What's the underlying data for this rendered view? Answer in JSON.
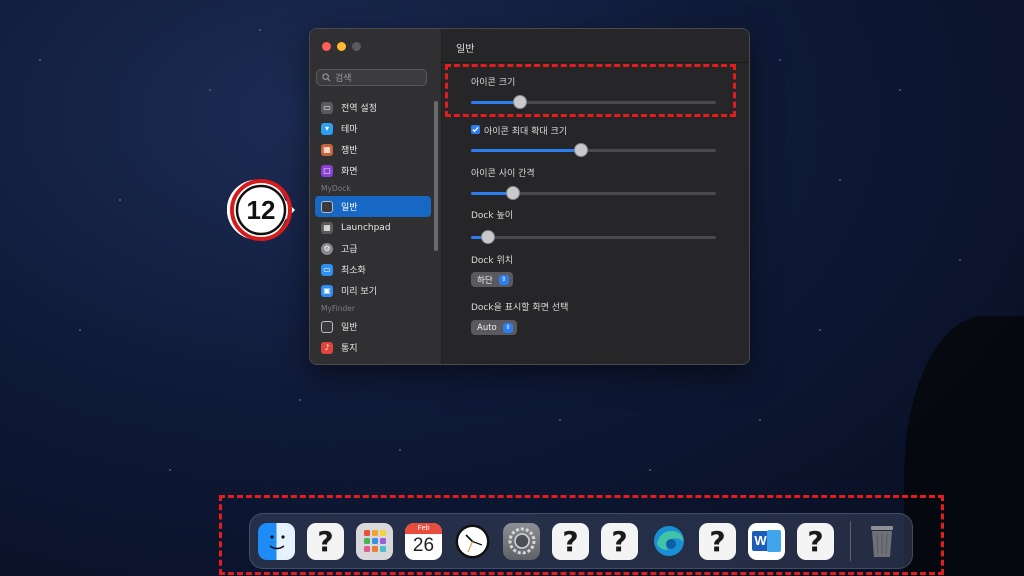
{
  "window": {
    "sidebar": {
      "search_placeholder": "검색",
      "sections": [
        {
          "header": "",
          "items": [
            {
              "label": "전역 설정",
              "icon": "display-icon",
              "color": "#5a5a5c"
            },
            {
              "label": "테마",
              "icon": "tshirt-icon",
              "color": "#2f9ff0"
            },
            {
              "label": "쟁반",
              "icon": "tray-grid-icon",
              "color": "#c8643c"
            },
            {
              "label": "화면",
              "icon": "screen-icon",
              "color": "#8a3fd8"
            }
          ]
        },
        {
          "header": "MyDock",
          "items": [
            {
              "label": "일반",
              "icon": "dock-general-icon",
              "color": "#4a4a4c",
              "selected": true
            },
            {
              "label": "Launchpad",
              "icon": "launchpad-icon",
              "color": "#5a5a5c"
            },
            {
              "label": "고급",
              "icon": "gear-icon",
              "color": "#8a8a8e"
            },
            {
              "label": "최소화",
              "icon": "minimize-icon",
              "color": "#2f8ff0"
            },
            {
              "label": "미리 보기",
              "icon": "preview-icon",
              "color": "#2f8ff0"
            }
          ]
        },
        {
          "header": "MyFinder",
          "items": [
            {
              "label": "일반",
              "icon": "finder-general-icon",
              "color": "#4a4a4c"
            },
            {
              "label": "통지",
              "icon": "notification-icon",
              "color": "#e0443c"
            }
          ]
        }
      ]
    },
    "content": {
      "title": "일반",
      "icon_size": {
        "label": "아이콘 크기",
        "value": 0.2
      },
      "max_magnify": {
        "label": "아이콘 최대 확대 크기",
        "checked": true,
        "value": 0.45
      },
      "icon_spacing": {
        "label": "아이콘 사이 간격",
        "value": 0.17
      },
      "dock_height": {
        "label": "Dock 높이",
        "value": 0.07
      },
      "dock_position": {
        "label": "Dock 위치",
        "value": "하단"
      },
      "dock_display": {
        "label": "Dock을 표시할 화면 선택",
        "value": "Auto"
      }
    }
  },
  "callout": {
    "number": "12"
  },
  "dock": {
    "items": [
      {
        "name": "finder",
        "icon": "finder-icon"
      },
      {
        "name": "unknown",
        "icon": "question-icon"
      },
      {
        "name": "launchpad",
        "icon": "launchpad-grid-icon"
      },
      {
        "name": "calendar",
        "icon": "calendar-icon",
        "month": "Feb",
        "day": "26"
      },
      {
        "name": "clock",
        "icon": "clock-icon"
      },
      {
        "name": "system-settings",
        "icon": "settings-icon"
      },
      {
        "name": "unknown",
        "icon": "question-icon"
      },
      {
        "name": "unknown",
        "icon": "question-icon"
      },
      {
        "name": "edge",
        "icon": "edge-icon"
      },
      {
        "name": "unknown",
        "icon": "question-icon"
      },
      {
        "name": "word",
        "icon": "word-icon"
      },
      {
        "name": "unknown",
        "icon": "question-icon"
      },
      {
        "name": "trash",
        "icon": "trash-icon"
      }
    ],
    "question_glyph": "?"
  },
  "colors": {
    "accent": "#2a7ef1",
    "highlight": "#e51c1c",
    "selection": "#1767c5"
  }
}
